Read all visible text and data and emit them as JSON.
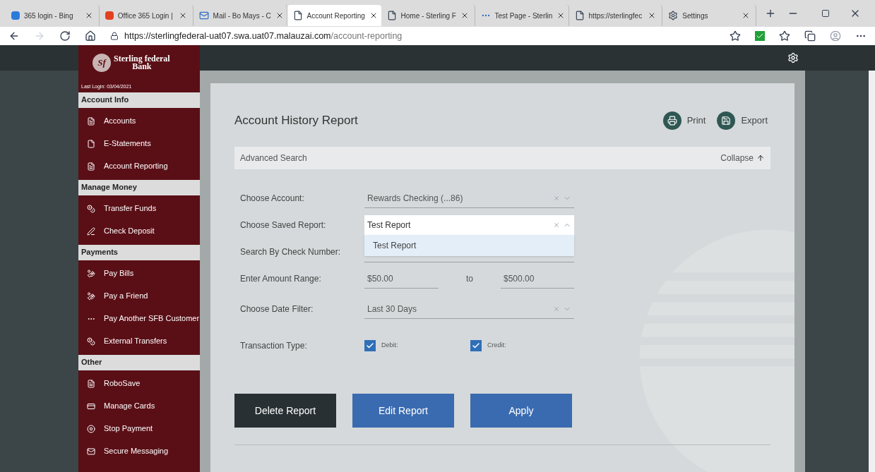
{
  "browser": {
    "tabs": [
      {
        "label": "365 login - Bing",
        "kind": "bing",
        "selected": false
      },
      {
        "label": "Office 365 Login |",
        "kind": "office",
        "selected": false
      },
      {
        "label": "Mail - Bo Mays - C",
        "kind": "mail",
        "selected": false
      },
      {
        "label": "Account Reporting",
        "kind": "page",
        "selected": true
      },
      {
        "label": "Home - Sterling F",
        "kind": "page",
        "selected": false
      },
      {
        "label": "Test Page - Sterlin",
        "kind": "dots",
        "selected": false
      },
      {
        "label": "https://sterlingfec",
        "kind": "page",
        "selected": false
      },
      {
        "label": "Settings",
        "kind": "gear",
        "selected": false
      }
    ],
    "url_host": "https://sterlingfederal-uat07.swa.uat07.malauzai.com",
    "url_path": "/account-reporting"
  },
  "sidebar": {
    "logo_mark": "Sf",
    "bank_name": "Sterling federal",
    "bank_name_2": "Bank",
    "last_login": "Last Login: 03/04/2021",
    "sections": [
      {
        "title": "Account Info",
        "items": [
          {
            "label": "Accounts",
            "kind": "doc"
          },
          {
            "label": "E-Statements",
            "kind": "file"
          },
          {
            "label": "Account Reporting",
            "kind": "doc"
          }
        ]
      },
      {
        "title": "Manage Money",
        "items": [
          {
            "label": "Transfer Funds",
            "kind": "coins"
          },
          {
            "label": "Check Deposit",
            "kind": "pen"
          }
        ]
      },
      {
        "title": "Payments",
        "items": [
          {
            "label": "Pay Bills",
            "kind": "hand"
          },
          {
            "label": "Pay a Friend",
            "kind": "hand"
          },
          {
            "label": "Pay Another SFB Customer",
            "kind": "dots"
          },
          {
            "label": "External Transfers",
            "kind": "coins"
          }
        ]
      },
      {
        "title": "Other",
        "items": [
          {
            "label": "RoboSave",
            "kind": "doc"
          },
          {
            "label": "Manage Cards",
            "kind": "card"
          },
          {
            "label": "Stop Payment",
            "kind": "stop"
          },
          {
            "label": "Secure Messaging",
            "kind": "mail"
          }
        ]
      }
    ]
  },
  "report": {
    "title": "Account History Report",
    "actions": [
      {
        "label": "Print",
        "kind": "print"
      },
      {
        "label": "Export",
        "kind": "save"
      }
    ],
    "advanced_search": {
      "title": "Advanced Search",
      "toggle": "Collapse",
      "expanded": true
    },
    "choose_account": {
      "label": "Choose Account:",
      "value": "Rewards Checking (...86)"
    },
    "saved_report": {
      "label": "Choose Saved Report:",
      "value": "Test Report",
      "expanded": true,
      "options": [
        {
          "label": "Test Report",
          "selected": true
        }
      ]
    },
    "check_number": {
      "label": "Search By Check Number:"
    },
    "amount_range": {
      "label": "Enter Amount Range:",
      "from": "$50.00",
      "separator": "to",
      "to": "$500.00"
    },
    "date_filter": {
      "label": "Choose Date Filter:",
      "value": "Last 30 Days"
    },
    "transaction_type": {
      "label": "Transaction Type:",
      "options": [
        {
          "label": "Debit:",
          "checked": true
        },
        {
          "label": "Credit:",
          "checked": true
        }
      ]
    },
    "buttons": [
      {
        "label": "Delete Report",
        "kind": "dark"
      },
      {
        "label": "Edit Report",
        "kind": "primary"
      },
      {
        "label": "Apply",
        "kind": "primary"
      }
    ]
  }
}
